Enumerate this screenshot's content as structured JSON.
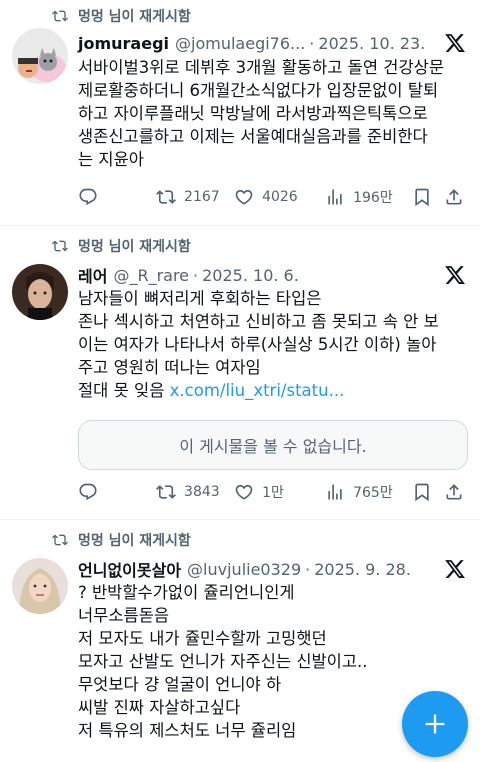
{
  "tweets": [
    {
      "repost_label": "멍멍 님이 재게시함",
      "name": "jomuraegi",
      "handle": "@jomulaegi76...",
      "date": "2025. 10. 23.",
      "lines": [
        "서바이벌3위로 데뷔후 3개월 활동하고 돌연 건강상문",
        "제로활중하더니 6개월간소식없다가 입장문없이 탈퇴",
        "하고 자이루플래닛 막방날에 라서방과찍은틱톡으로",
        "생존신고를하고 이제는 서울예대실음과를 준비한다",
        "는 지윤아"
      ],
      "stats": {
        "reposts": "2167",
        "likes": "4026",
        "views": "196만"
      }
    },
    {
      "repost_label": "멍멍 님이 재게시함",
      "name": "레어",
      "handle": "@_R_rare",
      "date": "2025. 10. 6.",
      "lines": [
        "남자들이 뼈저리게 후회하는 타입은",
        "존나 섹시하고 처연하고 신비하고 좀 못되고 속 안 보",
        "이는 여자가 나타나서 하루(사실상 5시간 이하) 놀아",
        "주고 영원히 떠나는 여자임",
        "절대 못 잊음"
      ],
      "link": "x.com/liu_xtri/statu...",
      "unavailable": "이 게시물을 볼 수 없습니다.",
      "stats": {
        "reposts": "3843",
        "likes": "1만",
        "views": "765만"
      }
    },
    {
      "repost_label": "멍멍 님이 재게시함",
      "name": "언니없이못살아",
      "handle": "@luvjulie0329",
      "date": "2025. 9. 28.",
      "lines": [
        "? 반박할수가없이 쥴리언니인게",
        "너무소름돋음",
        "저 모자도 내가 쥴민수할까 고밍햇던",
        "모자고 산발도 언니가 자주신는 신발이고..",
        "무엇보다 걍 얼굴이 언니야 하",
        "씨발 진짜 자살하고싶다",
        "저 특유의 제스처도 너무 쥴리임"
      ]
    }
  ],
  "colors": {
    "accent": "#1d9bf0",
    "secondary_text": "#536471",
    "primary_text": "#0f1419"
  },
  "icons": {
    "repost": "repost-icon",
    "reply": "reply-icon",
    "like": "heart-icon",
    "views": "views-icon",
    "x_logo": "x-logo-icon",
    "compose": "plus-icon"
  }
}
